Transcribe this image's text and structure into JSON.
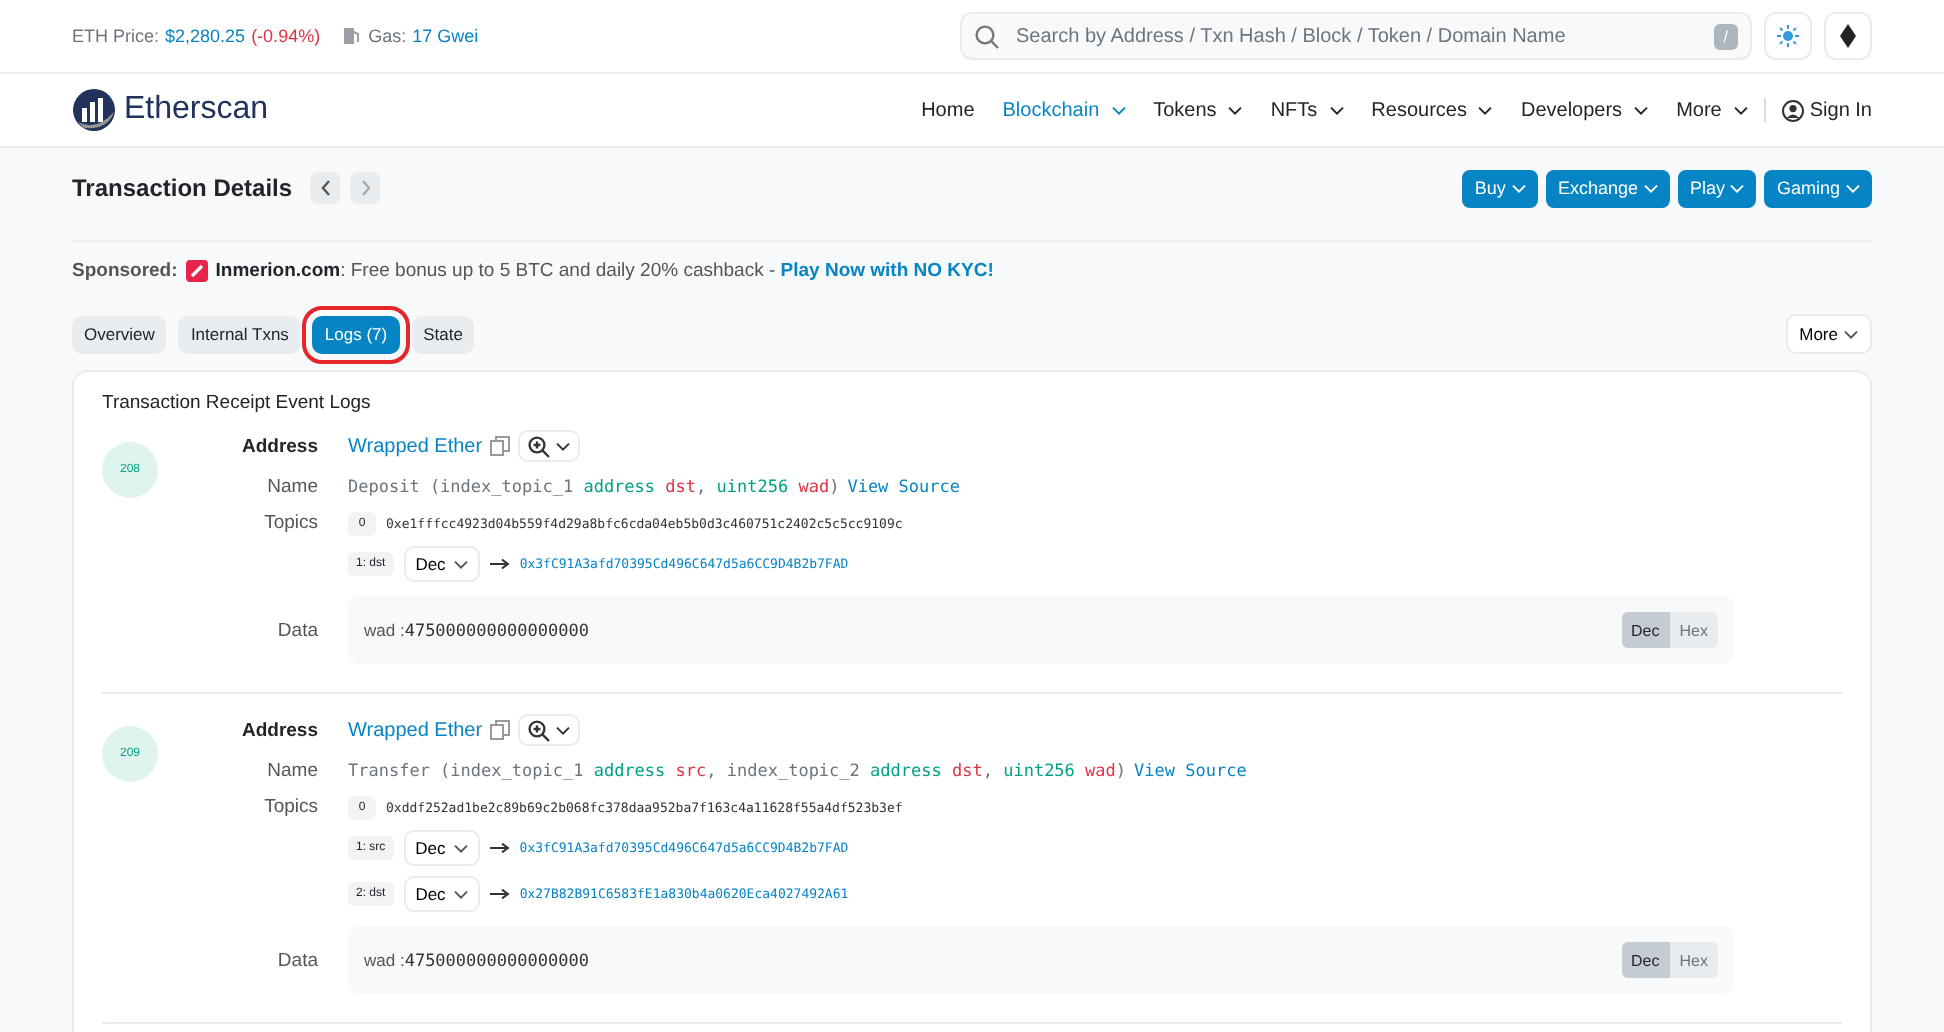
{
  "topbar": {
    "eth_price_label": "ETH Price:",
    "eth_price": "$2,280.25",
    "eth_change": "(-0.94%)",
    "gas_label": "Gas:",
    "gas": "17 Gwei",
    "search_placeholder": "Search by Address / Txn Hash / Block / Token / Domain Name",
    "search_key": "/"
  },
  "nav": {
    "logo": "Etherscan",
    "items": [
      {
        "label": "Home",
        "selected": false,
        "dropdown": false
      },
      {
        "label": "Blockchain",
        "selected": true,
        "dropdown": true
      },
      {
        "label": "Tokens",
        "selected": false,
        "dropdown": true
      },
      {
        "label": "NFTs",
        "selected": false,
        "dropdown": true
      },
      {
        "label": "Resources",
        "selected": false,
        "dropdown": true
      },
      {
        "label": "Developers",
        "selected": false,
        "dropdown": true
      },
      {
        "label": "More",
        "selected": false,
        "dropdown": true
      }
    ],
    "sign_in": "Sign In"
  },
  "page": {
    "title": "Transaction Details",
    "buttons": [
      "Buy",
      "Exchange",
      "Play",
      "Gaming"
    ]
  },
  "sponsored": {
    "label": "Sponsored:",
    "brand": "Inmerion.com",
    "text": ": Free bonus up to 5 BTC and daily 20% cashback - ",
    "link": "Play Now with NO KYC!"
  },
  "tabs": [
    {
      "label": "Overview",
      "selected": false,
      "highlighted": false
    },
    {
      "label": "Internal Txns",
      "selected": false,
      "highlighted": false
    },
    {
      "label": "Logs (7)",
      "selected": true,
      "highlighted": true
    },
    {
      "label": "State",
      "selected": false,
      "highlighted": false
    }
  ],
  "more_button": "More",
  "logs": {
    "title": "Transaction Receipt Event Logs",
    "entries": [
      {
        "index": "208",
        "address_label": "Address",
        "address": "Wrapped Ether",
        "name_label": "Name",
        "name_tokens": [
          {
            "kind": "text",
            "text": "Deposit (index_topic_1 "
          },
          {
            "kind": "type",
            "text": "address"
          },
          {
            "kind": "param",
            "text": " dst"
          },
          {
            "kind": "text",
            "text": ", "
          },
          {
            "kind": "type",
            "text": "uint256"
          },
          {
            "kind": "param",
            "text": " wad"
          },
          {
            "kind": "text",
            "text": ")"
          }
        ],
        "view_source": "View Source",
        "topics_label": "Topics",
        "topics": [
          {
            "tag": "0",
            "value": "0xe1fffcc4923d04b559f4d29a8bfc6cda04eb5b0d3c460751c2402c5c5cc9109c"
          },
          {
            "tag": "1: dst",
            "format": "Dec",
            "value": "0x3fC91A3afd70395Cd496C647d5a6CC9D4B2b7FAD"
          }
        ],
        "data_label": "Data",
        "data": {
          "field": "wad :",
          "value": "475000000000000000",
          "formats": [
            {
              "label": "Dec",
              "selected": true
            },
            {
              "label": "Hex",
              "selected": false
            }
          ]
        }
      },
      {
        "index": "209",
        "address_label": "Address",
        "address": "Wrapped Ether",
        "name_label": "Name",
        "name_tokens": [
          {
            "kind": "text",
            "text": "Transfer (index_topic_1 "
          },
          {
            "kind": "type",
            "text": "address"
          },
          {
            "kind": "param",
            "text": " src"
          },
          {
            "kind": "text",
            "text": ", index_topic_2 "
          },
          {
            "kind": "type",
            "text": "address"
          },
          {
            "kind": "param",
            "text": " dst"
          },
          {
            "kind": "text",
            "text": ", "
          },
          {
            "kind": "type",
            "text": "uint256"
          },
          {
            "kind": "param",
            "text": " wad"
          },
          {
            "kind": "text",
            "text": ")"
          }
        ],
        "view_source": "View Source",
        "topics_label": "Topics",
        "topics": [
          {
            "tag": "0",
            "value": "0xddf252ad1be2c89b69c2b068fc378daa952ba7f163c4a11628f55a4df523b3ef"
          },
          {
            "tag": "1: src",
            "format": "Dec",
            "value": "0x3fC91A3afd70395Cd496C647d5a6CC9D4B2b7FAD"
          },
          {
            "tag": "2: dst",
            "format": "Dec",
            "value": "0x27B82B91C6583fE1a830b4a0620Eca4027492A61"
          }
        ],
        "data_label": "Data",
        "data": {
          "field": "wad :",
          "value": "475000000000000000",
          "formats": [
            {
              "label": "Dec",
              "selected": true
            },
            {
              "label": "Hex",
              "selected": false
            }
          ]
        }
      }
    ]
  }
}
